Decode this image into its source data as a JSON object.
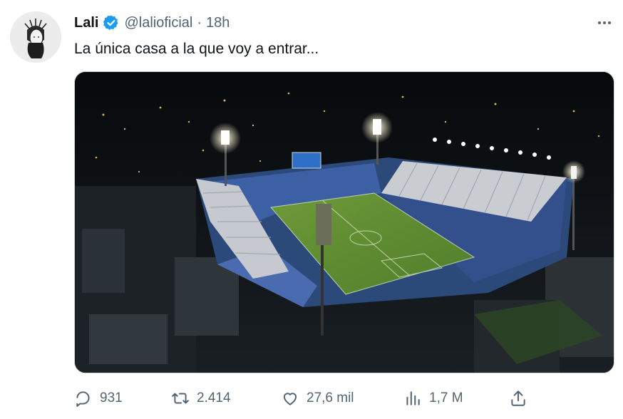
{
  "tweet": {
    "author_name": "Lali",
    "handle": "@lalioficial",
    "separator": "·",
    "time": "18h",
    "text": "La única casa a la que voy a entrar...",
    "verified_color": "#1d9bf0",
    "media": {
      "alt": "aerial-night-stadium-photo"
    }
  },
  "actions": {
    "replies": "931",
    "retweets": "2.414",
    "likes": "27,6 mil",
    "views": "1,7 M"
  },
  "icons": {
    "more": "more-dots-icon",
    "reply": "reply-icon",
    "retweet": "retweet-icon",
    "like": "heart-icon",
    "views": "views-chart-icon",
    "share": "share-icon"
  }
}
